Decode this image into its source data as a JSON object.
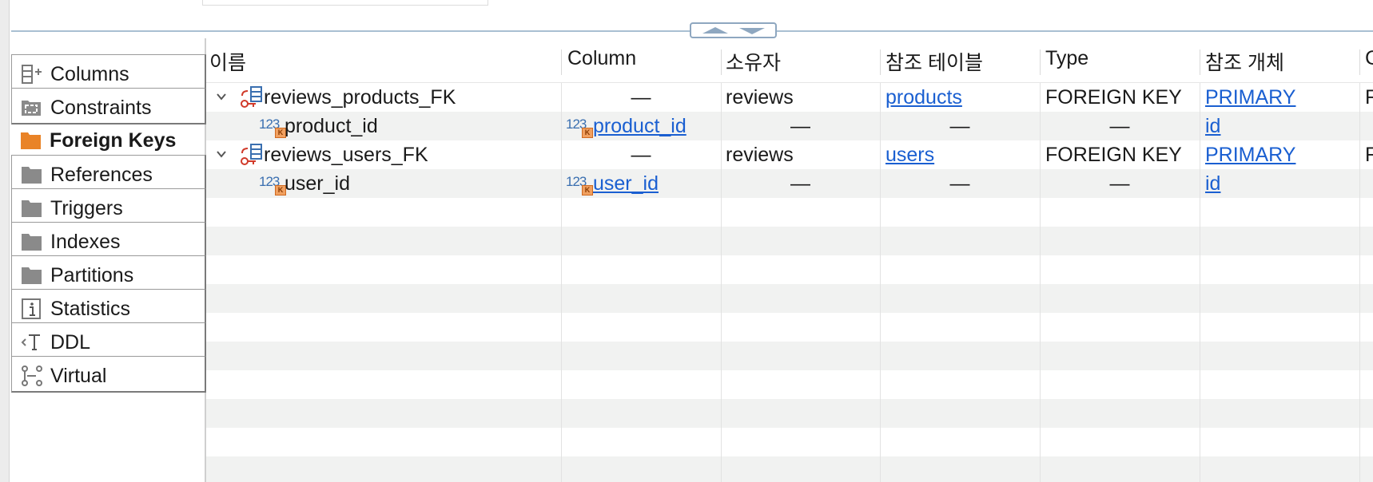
{
  "sidebar": {
    "tabs": [
      {
        "label": "Columns",
        "icon": "columns-icon"
      },
      {
        "label": "Constraints",
        "icon": "constraints-icon"
      },
      {
        "label": "Foreign Keys",
        "icon": "folder-icon",
        "active": true
      },
      {
        "label": "References",
        "icon": "folder-icon"
      },
      {
        "label": "Triggers",
        "icon": "folder-icon"
      },
      {
        "label": "Indexes",
        "icon": "folder-icon"
      },
      {
        "label": "Partitions",
        "icon": "folder-icon"
      },
      {
        "label": "Statistics",
        "icon": "info-icon"
      },
      {
        "label": "DDL",
        "icon": "ddl-icon"
      },
      {
        "label": "Virtual",
        "icon": "virtual-icon"
      }
    ]
  },
  "grid": {
    "headers": [
      "이름",
      "Column",
      "소유자",
      "참조 테이블",
      "Type",
      "참조 개체",
      "C"
    ],
    "dash": "—",
    "rows": [
      {
        "name": "reviews_products_FK",
        "column": "—",
        "owner": "reviews",
        "ref_table": "products",
        "type": "FOREIGN KEY",
        "ref_object": "PRIMARY",
        "extra": "R"
      },
      {
        "name": "product_id",
        "column": "product_id",
        "owner": "—",
        "ref_table": "—",
        "type": "—",
        "ref_object": "id",
        "extra": ""
      },
      {
        "name": "reviews_users_FK",
        "column": "—",
        "owner": "reviews",
        "ref_table": "users",
        "type": "FOREIGN KEY",
        "ref_object": "PRIMARY",
        "extra": "R"
      },
      {
        "name": "user_id",
        "column": "user_id",
        "owner": "—",
        "ref_table": "—",
        "type": "—",
        "ref_object": "id",
        "extra": ""
      }
    ],
    "num_icon_text": "123",
    "key_badge": "K"
  },
  "colors": {
    "accent_orange": "#e98327",
    "link_blue": "#1a5fd1",
    "row_alt": "#f1f2f1",
    "splitter": "#a9bfd2"
  }
}
